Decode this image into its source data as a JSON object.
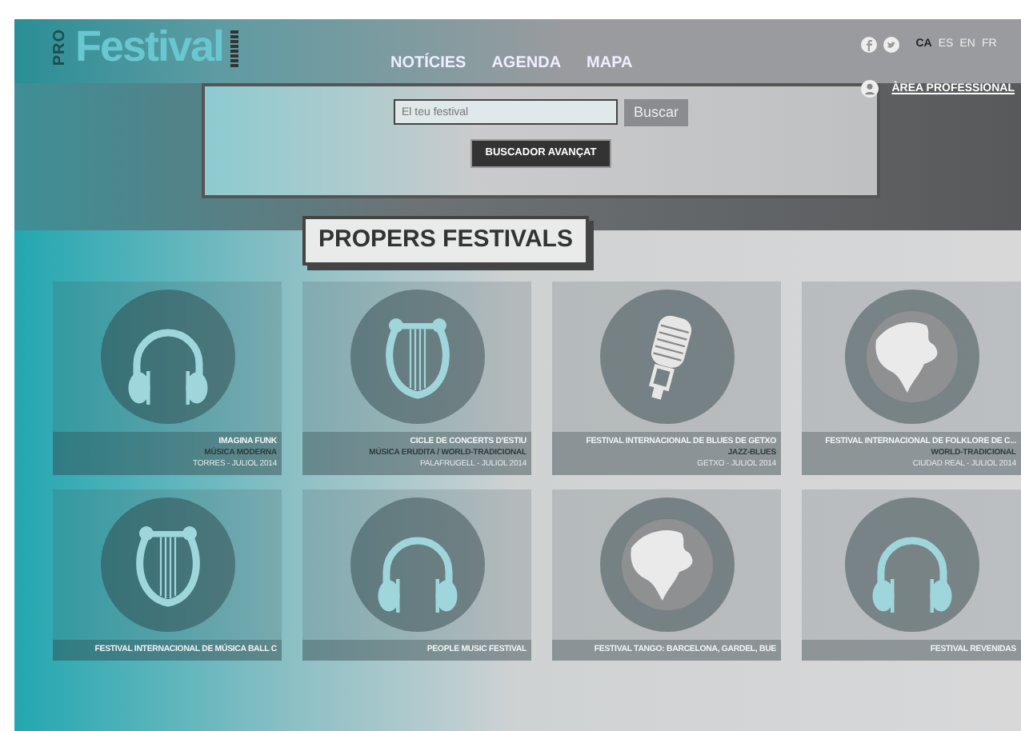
{
  "header": {
    "logo_prefix": "PRO",
    "logo": "Festival",
    "nav": [
      {
        "label": "NOTÍCIES"
      },
      {
        "label": "AGENDA"
      },
      {
        "label": "MAPA"
      }
    ],
    "languages": [
      {
        "label": "CA",
        "selected": true
      },
      {
        "label": "ES",
        "selected": false
      },
      {
        "label": "EN",
        "selected": false
      },
      {
        "label": "FR",
        "selected": false
      }
    ],
    "professional_link": "ÀREA PROFESSIONAL"
  },
  "search": {
    "placeholder": "El teu festival",
    "button": "Buscar",
    "advanced_button": "BUSCADOR AVANÇAT"
  },
  "section_title": "PROPERS FESTIVALS",
  "festivals": [
    {
      "kind": "headphones",
      "name": "IMAGINA FUNK",
      "genre": "MÚSICA MODERNA",
      "place_date": "TORRES - JULIOL 2014"
    },
    {
      "kind": "lyre",
      "name": "CICLE DE CONCERTS D'ESTIU",
      "genre": "MÚSICA ERUDITA / WORLD-TRADICIONAL",
      "place_date": "PALAFRUGELL - JULIOL 2014"
    },
    {
      "kind": "microphone",
      "name": "FESTIVAL INTERNACIONAL DE BLUES DE GETXO",
      "genre": "JAZZ-BLUES",
      "place_date": "GETXO - JULIOL 2014"
    },
    {
      "kind": "globe",
      "name": "FESTIVAL INTERNACIONAL DE FOLKLORE DE C...",
      "genre": "WORLD-TRADICIONAL",
      "place_date": "CIUDAD REAL - JULIOL 2014"
    },
    {
      "kind": "lyre",
      "name": "FESTIVAL INTERNACIONAL DE MÚSICA BALL C"
    },
    {
      "kind": "headphones",
      "name": "PEOPLE MUSIC FESTIVAL"
    },
    {
      "kind": "globe",
      "name": "FESTIVAL TANGO: BARCELONA, GARDEL, BUE"
    },
    {
      "kind": "headphones",
      "name": "FESTIVAL REVENIDAS"
    }
  ]
}
